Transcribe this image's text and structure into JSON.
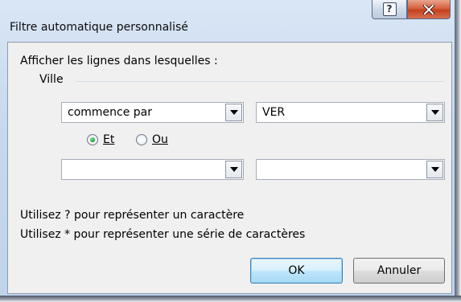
{
  "window": {
    "title": "Filtre automatique personnalisé",
    "help_glyph": "?",
    "close_glyph": "X"
  },
  "content": {
    "instruction": "Afficher les lignes dans lesquelles :",
    "field_name": "Ville"
  },
  "criteria": {
    "row1": {
      "operator": "commence par",
      "value": "VER"
    },
    "row2": {
      "operator": "",
      "value": ""
    }
  },
  "logic": {
    "and_label": "Et",
    "or_label": "Ou",
    "selected": "and"
  },
  "hints": {
    "line1": "Utilisez ? pour représenter un caractère",
    "line2": "Utilisez * pour représenter une série de caractères"
  },
  "buttons": {
    "ok": "OK",
    "cancel": "Annuler"
  },
  "colors": {
    "frame": "#c6d8ee",
    "close_button": "#c5401e",
    "default_button_border": "#3c7fb1",
    "radio_selected": "#1fa83a"
  },
  "icons": {
    "help": "help-icon",
    "close": "close-icon",
    "dropdown": "chevron-down-icon"
  }
}
